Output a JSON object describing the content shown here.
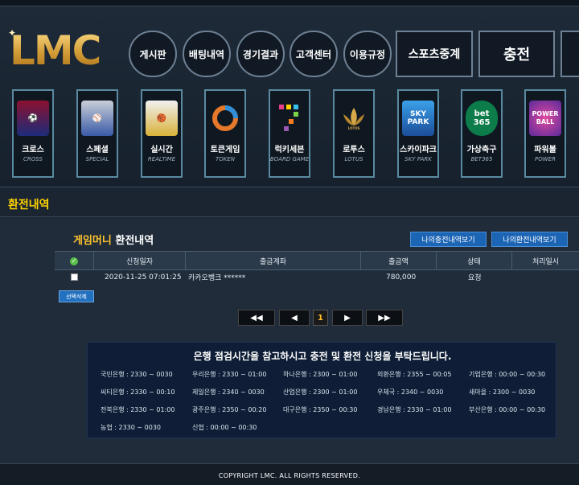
{
  "logo": "LMC",
  "nav": {
    "board": "게시판",
    "bets": "배팅내역",
    "results": "경기결과",
    "support": "고객센터",
    "rules": "이용규정",
    "sports": "스포츠중계",
    "charge": "충전"
  },
  "games": [
    {
      "name": "크로스",
      "sub": "CROSS"
    },
    {
      "name": "스페셜",
      "sub": "SPECIAL"
    },
    {
      "name": "실시간",
      "sub": "REALTIME"
    },
    {
      "name": "토큰게임",
      "sub": "TOKEN"
    },
    {
      "name": "럭키세븐",
      "sub": "BOARD GAME"
    },
    {
      "name": "로투스",
      "sub": "LOTUS"
    },
    {
      "name": "스카이파크",
      "sub": "SKY PARK"
    },
    {
      "name": "가상축구",
      "sub": "BET365"
    },
    {
      "name": "파워볼",
      "sub": "POWER"
    }
  ],
  "section_title": "환전내역",
  "sub_title": {
    "highlight": "게임머니",
    "rest": "환전내역"
  },
  "buttons": {
    "charge_history": "나의충전내역보기",
    "exchange_history": "나의환전내역보기",
    "delete_selected": "선택삭제"
  },
  "table": {
    "headers": [
      "신청일자",
      "출금계좌",
      "출금액",
      "상태",
      "처리일시"
    ],
    "rows": [
      {
        "date": "2020-11-25 07:01:25",
        "account": "카카오뱅크 ******",
        "amount": "780,000",
        "status": "요청",
        "processed": ""
      }
    ]
  },
  "pager": {
    "first": "◀◀",
    "prev": "◀",
    "current": "1",
    "next": "▶",
    "last": "▶▶"
  },
  "notice": {
    "title": "은행 점검시간을 참고하시고 충전 및 환전 신청을 부탁드립니다.",
    "banks": [
      [
        "국민은행 : 2330 ~ 0030",
        "우리은행 : 2330 ~ 01:00",
        "하나은행 : 2300 ~ 01:00",
        "외환은행 : 2355 ~ 00:05",
        "기업은행 : 00:00 ~ 00:30"
      ],
      [
        "씨티은행 : 2330 ~ 00:10",
        "제일은행 : 2340 ~ 0030",
        "산업은행 : 2300 ~ 01:00",
        "우체국 : 2340 ~ 0030",
        "새마을 : 2300 ~ 0030"
      ],
      [
        "전북은행 : 2330 ~ 01:00",
        "광주은행 : 2350 ~ 00:20",
        "대구은행 : 2350 ~ 00:30",
        "경남은행 : 2330 ~ 01:00",
        "부산은행 : 00:00 ~ 00:30"
      ],
      [
        "농협 : 2330 ~ 0030",
        "신협 : 00:00 ~ 00:30"
      ]
    ]
  },
  "footer": "COPYRIGHT LMC. ALL RIGHTS RESERVED.",
  "colors": {
    "accent_yellow": "#ffd200",
    "button_blue": "#1c64b4",
    "bg": "#1b2633"
  }
}
